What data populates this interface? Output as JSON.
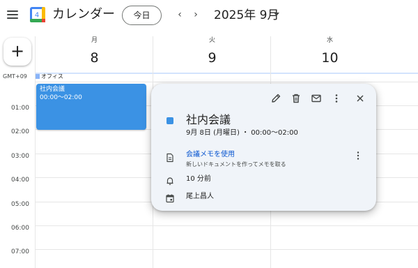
{
  "header": {
    "app_title": "カレンダー",
    "logo_number": "4",
    "today_label": "今日",
    "prev_symbol": "‹",
    "next_symbol": "›",
    "month_label": "2025年 9月"
  },
  "create": {
    "symbol": "+"
  },
  "days": [
    {
      "name": "月",
      "number": "8"
    },
    {
      "name": "火",
      "number": "9"
    },
    {
      "name": "水",
      "number": "10"
    }
  ],
  "allday": {
    "timezone": "GMT+09",
    "chip_label": "オフィス"
  },
  "hours": [
    "01:00",
    "02:00",
    "03:00",
    "04:00",
    "05:00",
    "06:00",
    "07:00"
  ],
  "event": {
    "title": "社内会議",
    "time": "00:00〜02:00",
    "color": "#3b92e4"
  },
  "popup": {
    "title": "社内会議",
    "datetime": "9月 8日 (月曜日) ・ 00:00〜02:00",
    "notes_link": "会議メモを使用",
    "notes_hint": "新しいドキュメントを作ってメモを取る",
    "reminder": "10 分前",
    "organizer": "尾上昌人",
    "icons": [
      "edit-icon",
      "delete-icon",
      "email-icon",
      "more-options-icon",
      "close-icon",
      "document-icon",
      "bell-icon",
      "calendar-icon"
    ]
  },
  "colors": {
    "accent": "#0b57d0",
    "event": "#3b92e4",
    "popup_bg": "#f0f4f9"
  }
}
